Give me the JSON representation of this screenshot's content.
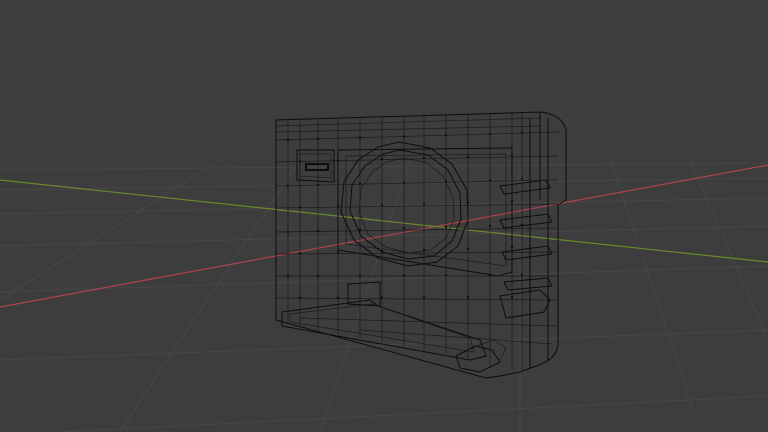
{
  "viewport": {
    "background": "#3d3d3d",
    "grid_color": "#474747",
    "x_axis_color": "#b2434e",
    "y_axis_color": "#6a8a2c",
    "wire_color": "#0c0c0c",
    "icons": [
      "viewport-grid",
      "x-axis-line",
      "y-axis-line",
      "wireframe-mesh"
    ],
    "shading_mode": "wireframe"
  }
}
